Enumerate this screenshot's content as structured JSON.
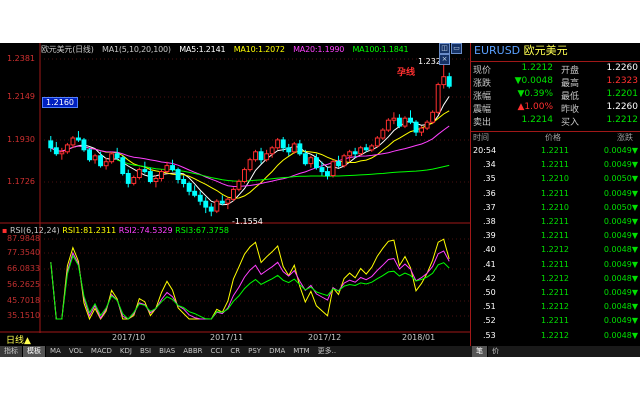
{
  "title_bar": {
    "symbol_name": "欧元美元(日线)",
    "ma_settings": "MA1(5,10,20,100)",
    "ma5": "MA5:1.2141",
    "ma10": "MA10:1.2072",
    "ma20": "MA20:1.1990",
    "ma100": "MA100:1.1841",
    "colors": {
      "ma5": "#ffffff",
      "ma10": "#ffff00",
      "ma20": "#ff40ff",
      "ma100": "#00ff00"
    }
  },
  "y_axis_labels": [
    "1.2381",
    "1.2149",
    "1.1930",
    "1.1726"
  ],
  "current_price_marker": "1.2160",
  "high_label": "1.2323",
  "low_label": "1.1554",
  "annotation": "孕线",
  "rsi": {
    "title": "RSI(6,12,24)",
    "rsi1": "RSI1:81.2311",
    "rsi2": "RSI2:74.5329",
    "rsi3": "RSI3:67.3758",
    "axis_labels": [
      "87.9848",
      "77.3540",
      "66.0833",
      "56.2625",
      "45.7018",
      "35.1510"
    ],
    "colors": {
      "rsi1": "#ffff00",
      "rsi2": "#ff40ff",
      "rsi3": "#00ff00"
    }
  },
  "period_selector": "日线▲",
  "x_axis_labels": [
    "2017/10",
    "2017/11",
    "2017/12",
    "2018/01"
  ],
  "quote_panel": {
    "header_code": "EURUSD",
    "header_name": "欧元美元",
    "rows": [
      {
        "l1": "现价",
        "v1": "1.2212",
        "c1": "#00e000",
        "l2": "开盘",
        "v2": "1.2260",
        "c2": "#ffffff"
      },
      {
        "l1": "涨跌",
        "v1": "▼0.0048",
        "c1": "#00e000",
        "l2": "最高",
        "v2": "1.2323",
        "c2": "#ff3030"
      },
      {
        "l1": "涨幅",
        "v1": "▼0.39%",
        "c1": "#00e000",
        "l2": "最低",
        "v2": "1.2201",
        "c2": "#00e000"
      },
      {
        "l1": "震幅",
        "v1": "▲1.00%",
        "c1": "#ff3030",
        "l2": "昨收",
        "v2": "1.2260",
        "c2": "#ffffff"
      },
      {
        "l1": "卖出",
        "v1": "1.2214",
        "c1": "#00e000",
        "l2": "买入",
        "v2": "1.2212",
        "c2": "#00e000"
      }
    ]
  },
  "ticks": {
    "headers": [
      "时间",
      "价格",
      "涨跌"
    ],
    "rows": [
      {
        "time": "20:54",
        "price": "1.2211",
        "chg": "0.0049▼"
      },
      {
        "time": ".34",
        "price": "1.2211",
        "chg": "0.0049▼"
      },
      {
        "time": ".35",
        "price": "1.2210",
        "chg": "0.0050▼"
      },
      {
        "time": ".36",
        "price": "1.2211",
        "chg": "0.0049▼"
      },
      {
        "time": ".37",
        "price": "1.2210",
        "chg": "0.0050▼"
      },
      {
        "time": ".38",
        "price": "1.2211",
        "chg": "0.0049▼"
      },
      {
        "time": ".39",
        "price": "1.2211",
        "chg": "0.0049▼"
      },
      {
        "time": ".40",
        "price": "1.2212",
        "chg": "0.0048▼"
      },
      {
        "time": ".41",
        "price": "1.2211",
        "chg": "0.0049▼"
      },
      {
        "time": ".42",
        "price": "1.2212",
        "chg": "0.0048▼"
      },
      {
        "time": ".50",
        "price": "1.2211",
        "chg": "0.0049▼"
      },
      {
        "time": ".51",
        "price": "1.2212",
        "chg": "0.0048▼"
      },
      {
        "time": ".52",
        "price": "1.2211",
        "chg": "0.0049▼"
      },
      {
        "time": ".53",
        "price": "1.2212",
        "chg": "0.0048▼"
      }
    ]
  },
  "bottom_tabs": [
    "指标",
    "模板",
    "MA",
    "VOL",
    "MACD",
    "KDJ",
    "BSI",
    "BIAS",
    "ABBR",
    "CCI",
    "CR",
    "PSY",
    "DMA",
    "MTM",
    "更多.."
  ],
  "bottom_right_tabs": [
    "笔",
    "价"
  ],
  "candles": [
    [
      1.1935,
      1.196,
      1.188,
      1.19
    ],
    [
      1.19,
      1.193,
      1.186,
      1.187
    ],
    [
      1.187,
      1.19,
      1.184,
      1.188
    ],
    [
      1.188,
      1.1925,
      1.187,
      1.1915
    ],
    [
      1.1915,
      1.196,
      1.19,
      1.195
    ],
    [
      1.195,
      1.1985,
      1.193,
      1.194
    ],
    [
      1.194,
      1.195,
      1.188,
      1.189
    ],
    [
      1.189,
      1.19,
      1.183,
      1.184
    ],
    [
      1.184,
      1.187,
      1.182,
      1.186
    ],
    [
      1.186,
      1.188,
      1.18,
      1.181
    ],
    [
      1.181,
      1.185,
      1.179,
      1.183
    ],
    [
      1.183,
      1.188,
      1.182,
      1.187
    ],
    [
      1.187,
      1.19,
      1.184,
      1.185
    ],
    [
      1.185,
      1.186,
      1.176,
      1.177
    ],
    [
      1.177,
      1.179,
      1.17,
      1.172
    ],
    [
      1.172,
      1.176,
      1.171,
      1.175
    ],
    [
      1.175,
      1.18,
      1.174,
      1.179
    ],
    [
      1.179,
      1.183,
      1.177,
      1.178
    ],
    [
      1.178,
      1.18,
      1.172,
      1.173
    ],
    [
      1.173,
      1.176,
      1.17,
      1.1745
    ],
    [
      1.1745,
      1.179,
      1.173,
      1.178
    ],
    [
      1.178,
      1.183,
      1.177,
      1.181
    ],
    [
      1.181,
      1.184,
      1.178,
      1.179
    ],
    [
      1.179,
      1.18,
      1.172,
      1.174
    ],
    [
      1.174,
      1.176,
      1.17,
      1.172
    ],
    [
      1.172,
      1.173,
      1.166,
      1.168
    ],
    [
      1.168,
      1.171,
      1.165,
      1.166
    ],
    [
      1.166,
      1.168,
      1.161,
      1.163
    ],
    [
      1.163,
      1.165,
      1.157,
      1.16
    ],
    [
      1.16,
      1.162,
      1.1554,
      1.158
    ],
    [
      1.158,
      1.164,
      1.157,
      1.163
    ],
    [
      1.163,
      1.166,
      1.161,
      1.162
    ],
    [
      1.162,
      1.165,
      1.159,
      1.164
    ],
    [
      1.164,
      1.17,
      1.163,
      1.169
    ],
    [
      1.169,
      1.174,
      1.168,
      1.173
    ],
    [
      1.173,
      1.18,
      1.172,
      1.179
    ],
    [
      1.179,
      1.185,
      1.178,
      1.184
    ],
    [
      1.184,
      1.189,
      1.183,
      1.188
    ],
    [
      1.188,
      1.19,
      1.182,
      1.184
    ],
    [
      1.184,
      1.189,
      1.183,
      1.187
    ],
    [
      1.187,
      1.191,
      1.185,
      1.19
    ],
    [
      1.19,
      1.195,
      1.189,
      1.194
    ],
    [
      1.194,
      1.1955,
      1.188,
      1.19
    ],
    [
      1.19,
      1.192,
      1.186,
      1.188
    ],
    [
      1.188,
      1.193,
      1.187,
      1.192
    ],
    [
      1.192,
      1.194,
      1.186,
      1.187
    ],
    [
      1.187,
      1.189,
      1.181,
      1.182
    ],
    [
      1.182,
      1.186,
      1.18,
      1.185
    ],
    [
      1.185,
      1.187,
      1.179,
      1.18
    ],
    [
      1.18,
      1.183,
      1.176,
      1.178
    ],
    [
      1.178,
      1.18,
      1.174,
      1.176
    ],
    [
      1.176,
      1.184,
      1.175,
      1.183
    ],
    [
      1.183,
      1.186,
      1.18,
      1.181
    ],
    [
      1.181,
      1.187,
      1.18,
      1.186
    ],
    [
      1.186,
      1.189,
      1.183,
      1.188
    ],
    [
      1.188,
      1.19,
      1.185,
      1.187
    ],
    [
      1.187,
      1.191,
      1.186,
      1.19
    ],
    [
      1.19,
      1.192,
      1.188,
      1.189
    ],
    [
      1.189,
      1.192,
      1.188,
      1.191
    ],
    [
      1.191,
      1.196,
      1.19,
      1.195
    ],
    [
      1.195,
      1.2,
      1.194,
      1.199
    ],
    [
      1.199,
      1.205,
      1.198,
      1.204
    ],
    [
      1.204,
      1.208,
      1.202,
      1.205
    ],
    [
      1.205,
      1.207,
      1.2,
      1.201
    ],
    [
      1.201,
      1.206,
      1.2,
      1.205
    ],
    [
      1.205,
      1.209,
      1.202,
      1.203
    ],
    [
      1.203,
      1.204,
      1.196,
      1.198
    ],
    [
      1.198,
      1.201,
      1.196,
      1.2
    ],
    [
      1.2,
      1.204,
      1.199,
      1.203
    ],
    [
      1.203,
      1.209,
      1.202,
      1.208
    ],
    [
      1.208,
      1.223,
      1.207,
      1.222
    ],
    [
      1.222,
      1.2323,
      1.22,
      1.226
    ],
    [
      1.226,
      1.228,
      1.2201,
      1.2212
    ]
  ]
}
